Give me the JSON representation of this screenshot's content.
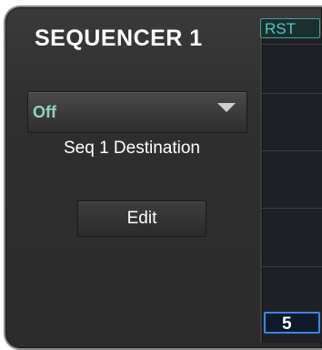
{
  "panel": {
    "title": "SEQUENCER 1"
  },
  "destination": {
    "selected": "Off",
    "label": "Seq 1 Destination"
  },
  "edit_button": {
    "label": "Edit"
  },
  "grid": {
    "reset_label": "RST",
    "steps_value": "5"
  },
  "icons": {
    "dropdown_arrow": "triangle-down"
  },
  "colors": {
    "dropdown_text": "#8fd6b4",
    "rst_text": "#4fc9bf",
    "steps_border": "#3c86de"
  }
}
